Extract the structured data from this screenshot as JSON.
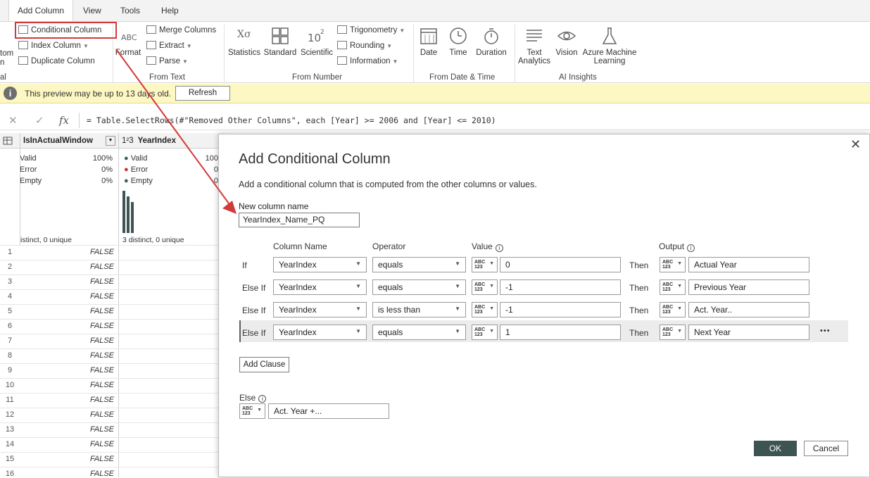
{
  "tabs": [
    {
      "label": "Add Column",
      "active": true
    },
    {
      "label": "View",
      "active": false
    },
    {
      "label": "Tools",
      "active": false
    },
    {
      "label": "Help",
      "active": false
    }
  ],
  "ribbon": {
    "cut_left": {
      "top": "tom",
      "mid": "n",
      "group": "al"
    },
    "general": {
      "conditional_column": "Conditional Column",
      "index_column": "Index Column",
      "duplicate_column": "Duplicate Column"
    },
    "format_label": "Format",
    "from_text": {
      "merge_columns": "Merge Columns",
      "extract": "Extract",
      "parse": "Parse",
      "group": "From Text"
    },
    "from_number": {
      "statistics": "Statistics",
      "standard": "Standard",
      "scientific": "Scientific",
      "trigonometry": "Trigonometry",
      "rounding": "Rounding",
      "information": "Information",
      "group": "From Number"
    },
    "from_date_time": {
      "date": "Date",
      "time": "Time",
      "duration": "Duration",
      "group": "From Date & Time"
    },
    "ai_insights": {
      "text_analytics_1": "Text",
      "text_analytics_2": "Analytics",
      "vision": "Vision",
      "azure_ml_1": "Azure Machine",
      "azure_ml_2": "Learning",
      "group": "AI Insights"
    }
  },
  "infobar": {
    "message": "This preview may be up to 13 days old.",
    "refresh_label": "Refresh"
  },
  "formula_bar": {
    "fx": "fx",
    "formula": "= Table.SelectRows(#\"Removed Other Columns\", each [Year] >= 2006 and [Year] <= 2010)"
  },
  "grid": {
    "col1_header": "IsInActualWindow",
    "col2_header": "YearIndex",
    "col2_type": "1²3",
    "col1_profile": {
      "valid_label": "Valid",
      "valid_pct": "100%",
      "error_label": "Error",
      "error_pct": "0%",
      "empty_label": "Empty",
      "empty_pct": "0%",
      "distinct": "istinct, 0 unique"
    },
    "col2_profile": {
      "valid_label": "Valid",
      "valid_pct": "100",
      "error_label": "Error",
      "error_pct": "0",
      "empty_label": "Empty",
      "empty_pct": "0",
      "distinct": "3 distinct, 0 unique"
    },
    "rows": [
      "1",
      "2",
      "3",
      "4",
      "5",
      "6",
      "7",
      "8",
      "9",
      "10",
      "11",
      "12",
      "13",
      "14",
      "15",
      "16"
    ],
    "cell_value": "FALSE"
  },
  "dialog": {
    "title": "Add Conditional Column",
    "description": "Add a conditional column that is computed from the other columns or values.",
    "new_column_label": "New column name",
    "new_column_value": "YearIndex_Name_PQ",
    "headers": {
      "column_name": "Column Name",
      "operator": "Operator",
      "value": "Value",
      "output": "Output"
    },
    "type_badge_top": "ABC",
    "type_badge_bottom": "123",
    "then_label": "Then",
    "clauses": [
      {
        "prefix": "If",
        "column": "YearIndex",
        "operator": "equals",
        "value": "0",
        "output": "Actual Year"
      },
      {
        "prefix": "Else If",
        "column": "YearIndex",
        "operator": "equals",
        "value": "-1",
        "output": "Previous Year"
      },
      {
        "prefix": "Else If",
        "column": "YearIndex",
        "operator": "is less than",
        "value": "-1",
        "output": "Act. Year.."
      },
      {
        "prefix": "Else If",
        "column": "YearIndex",
        "operator": "equals",
        "value": "1",
        "output": "Next Year"
      }
    ],
    "more_label": "•••",
    "add_clause_label": "Add Clause",
    "else_label": "Else",
    "else_value": "Act. Year +...",
    "ok_label": "OK",
    "cancel_label": "Cancel",
    "close_label": "✕"
  },
  "colors": {
    "annotation_red": "#d03a3a",
    "ok_button": "#3e5453",
    "infobar_bg": "#fdf7c3"
  }
}
